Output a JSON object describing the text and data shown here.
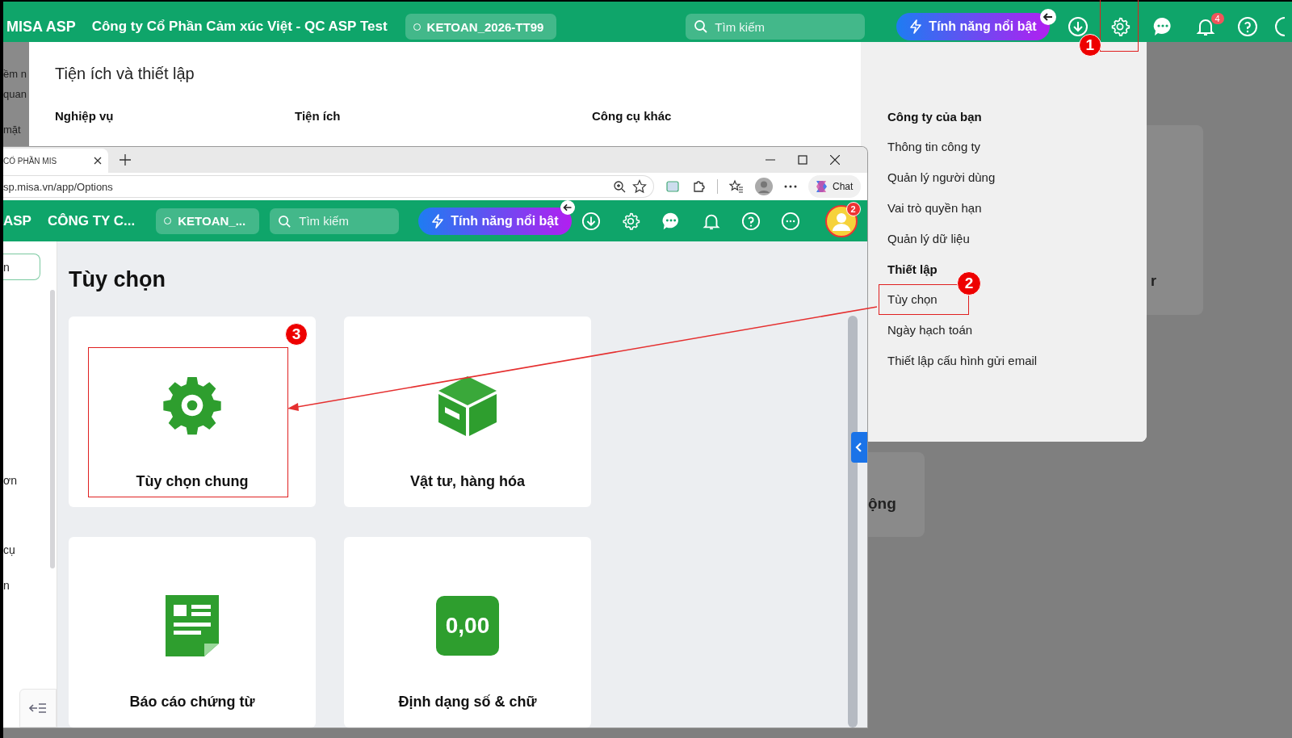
{
  "top_bar": {
    "brand": "MISA ASP",
    "company": "Công ty Cổ Phần Cảm xúc Việt - QC ASP Test",
    "database": "KETOAN_2026-TT99",
    "search": {
      "placeholder": "Tìm kiếm"
    },
    "feature_button": "Tính năng nổi bật",
    "settings_highlighted": true,
    "settings_step": "1",
    "notification_count": "4"
  },
  "background_fragments": [
    "ềm n",
    "quan",
    "mặt"
  ],
  "background_cards": [
    "r",
    "ộng"
  ],
  "popup": {
    "title": "Tiện ích và thiết lập",
    "columns": [
      "Nghiệp vụ",
      "Tiện ích",
      "Công cụ khác"
    ],
    "side_sections": [
      {
        "heading": "Công ty của bạn",
        "items": [
          {
            "label": "Thông tin công ty",
            "highlighted": false
          },
          {
            "label": "Quản lý người dùng",
            "highlighted": false
          },
          {
            "label": "Vai trò quyền hạn",
            "highlighted": false
          },
          {
            "label": "Quản lý dữ liệu",
            "highlighted": false
          }
        ]
      },
      {
        "heading": "Thiết lập",
        "items": [
          {
            "label": "Tùy chọn",
            "highlighted": true,
            "step": "2"
          },
          {
            "label": "Ngày hạch toán",
            "highlighted": false
          },
          {
            "label": "Thiết lập cấu hình gửi email",
            "highlighted": false
          }
        ]
      }
    ]
  },
  "browser": {
    "tab_title": "CỔ PHẦN MIS",
    "address": "sp.misa.vn/app/Options",
    "chat_button": "Chat",
    "app_bar": {
      "brand": "ASP",
      "company": "CÔNG TY C...",
      "database": "KETOAN_...",
      "search": {
        "placeholder": "Tìm kiếm"
      },
      "feature_button": "Tính năng nổi bật",
      "avatar_badge": "2"
    },
    "sidebar": {
      "button_fragment": "n",
      "fragments": [
        "ơn",
        "cụ",
        "n"
      ]
    },
    "page_title": "Tùy chọn",
    "cards": [
      {
        "label": "Tùy chọn chung",
        "kind": "gear",
        "highlighted": true,
        "step": "3"
      },
      {
        "label": "Vật tư, hàng hóa",
        "kind": "box",
        "highlighted": false
      },
      {
        "label": "Báo cáo chứng từ",
        "kind": "document",
        "highlighted": false
      },
      {
        "label": "Định dạng số & chữ",
        "kind": "number",
        "icon_text": "0,00",
        "highlighted": false
      }
    ]
  }
}
